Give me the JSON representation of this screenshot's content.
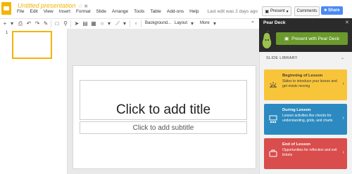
{
  "app": {
    "doc_title": "Untitled presentation",
    "title_icons": [
      "star-icon",
      "folder-icon"
    ],
    "menu": [
      "File",
      "Edit",
      "View",
      "Insert",
      "Format",
      "Slide",
      "Arrange",
      "Tools",
      "Table",
      "Add-ons",
      "Help"
    ],
    "last_edit": "Last edit was 2 days ago"
  },
  "header_buttons": {
    "present": "Present",
    "comments": "Comments",
    "share": "Share"
  },
  "toolbar": {
    "background": "Background...",
    "layout": "Layout",
    "more": "More"
  },
  "filmstrip": {
    "slide_number": "1"
  },
  "slide": {
    "title_placeholder": "Click to add title",
    "subtitle_placeholder": "Click to add subtitle"
  },
  "sidebar": {
    "title": "Pear Deck",
    "present_button": "Present with Pear Deck",
    "library_label": "SLIDE LIBRARY",
    "cards": [
      {
        "title": "Beginning of Lesson",
        "desc": "Slides to introduce your lesson and get minds moving"
      },
      {
        "title": "During Lesson",
        "desc": "Lesson activities like checks for understanding, grids, and charts"
      },
      {
        "title": "End of Lesson",
        "desc": "Opportunities for reflection and exit tickets"
      }
    ]
  },
  "colors": {
    "brand_yellow": "#f4b400",
    "share_blue": "#4a8af4",
    "pear_green": "#6a9a2c",
    "card_yellow": "#f8c53a",
    "card_blue": "#2c8ac0",
    "card_red": "#d94d4d"
  }
}
